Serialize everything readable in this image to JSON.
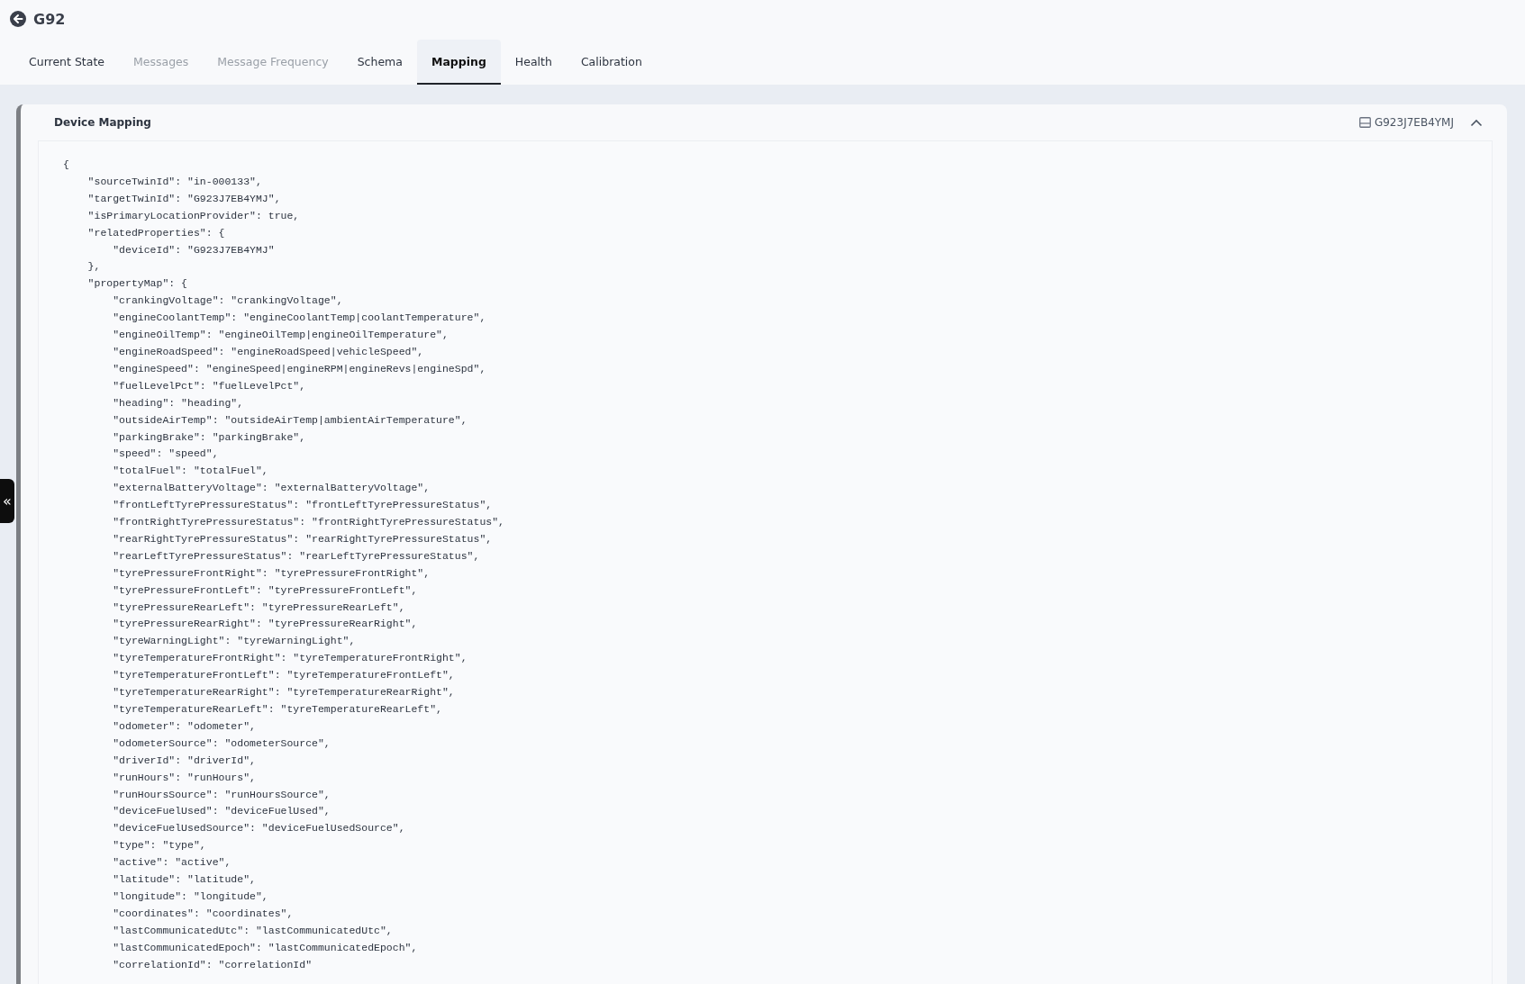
{
  "header": {
    "title": "G92"
  },
  "tabs": [
    {
      "label": "Current State",
      "selected": false,
      "disabled": false
    },
    {
      "label": "Messages",
      "selected": false,
      "disabled": true
    },
    {
      "label": "Message Frequency",
      "selected": false,
      "disabled": true
    },
    {
      "label": "Schema",
      "selected": false,
      "disabled": false
    },
    {
      "label": "Mapping",
      "selected": true,
      "disabled": false
    },
    {
      "label": "Health",
      "selected": false,
      "disabled": false
    },
    {
      "label": "Calibration",
      "selected": false,
      "disabled": false
    }
  ],
  "panel": {
    "title": "Device Mapping",
    "device_id": "G923J7EB4YMJ",
    "expanded": true
  },
  "sidebar_toggle": {
    "label": "«"
  },
  "code_lines": [
    "{",
    "    \"sourceTwinId\": \"in-000133\",",
    "    \"targetTwinId\": \"G923J7EB4YMJ\",",
    "    \"isPrimaryLocationProvider\": true,",
    "    \"relatedProperties\": {",
    "        \"deviceId\": \"G923J7EB4YMJ\"",
    "    },",
    "    \"propertyMap\": {",
    "        \"crankingVoltage\": \"crankingVoltage\",",
    "        \"engineCoolantTemp\": \"engineCoolantTemp|coolantTemperature\",",
    "        \"engineOilTemp\": \"engineOilTemp|engineOilTemperature\",",
    "        \"engineRoadSpeed\": \"engineRoadSpeed|vehicleSpeed\",",
    "        \"engineSpeed\": \"engineSpeed|engineRPM|engineRevs|engineSpd\",",
    "        \"fuelLevelPct\": \"fuelLevelPct\",",
    "        \"heading\": \"heading\",",
    "        \"outsideAirTemp\": \"outsideAirTemp|ambientAirTemperature\",",
    "        \"parkingBrake\": \"parkingBrake\",",
    "        \"speed\": \"speed\",",
    "        \"totalFuel\": \"totalFuel\",",
    "        \"externalBatteryVoltage\": \"externalBatteryVoltage\",",
    "        \"frontLeftTyrePressureStatus\": \"frontLeftTyrePressureStatus\",",
    "        \"frontRightTyrePressureStatus\": \"frontRightTyrePressureStatus\",",
    "        \"rearRightTyrePressureStatus\": \"rearRightTyrePressureStatus\",",
    "        \"rearLeftTyrePressureStatus\": \"rearLeftTyrePressureStatus\",",
    "        \"tyrePressureFrontRight\": \"tyrePressureFrontRight\",",
    "        \"tyrePressureFrontLeft\": \"tyrePressureFrontLeft\",",
    "        \"tyrePressureRearLeft\": \"tyrePressureRearLeft\",",
    "        \"tyrePressureRearRight\": \"tyrePressureRearRight\",",
    "        \"tyreWarningLight\": \"tyreWarningLight\",",
    "        \"tyreTemperatureFrontRight\": \"tyreTemperatureFrontRight\",",
    "        \"tyreTemperatureFrontLeft\": \"tyreTemperatureFrontLeft\",",
    "        \"tyreTemperatureRearRight\": \"tyreTemperatureRearRight\",",
    "        \"tyreTemperatureRearLeft\": \"tyreTemperatureRearLeft\",",
    "        \"odometer\": \"odometer\",",
    "        \"odometerSource\": \"odometerSource\",",
    "        \"driverId\": \"driverId\",",
    "        \"runHours\": \"runHours\",",
    "        \"runHoursSource\": \"runHoursSource\",",
    "        \"deviceFuelUsed\": \"deviceFuelUsed\",",
    "        \"deviceFuelUsedSource\": \"deviceFuelUsedSource\",",
    "        \"type\": \"type\",",
    "        \"active\": \"active\",",
    "        \"latitude\": \"latitude\",",
    "        \"longitude\": \"longitude\",",
    "        \"coordinates\": \"coordinates\",",
    "        \"lastCommunicatedUtc\": \"lastCommunicatedUtc\",",
    "        \"lastCommunicatedEpoch\": \"lastCommunicatedEpoch\",",
    "        \"correlationId\": \"correlationId\""
  ]
}
